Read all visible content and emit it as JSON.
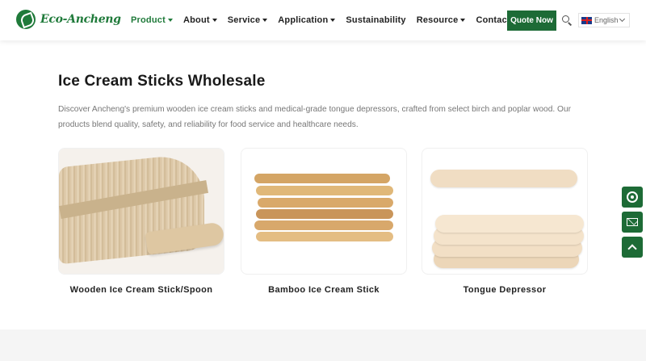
{
  "brand": {
    "name": "Eco-Ancheng",
    "accent": "#1d6b36"
  },
  "nav": {
    "items": [
      {
        "label": "Product",
        "dropdown": true,
        "active": true
      },
      {
        "label": "About",
        "dropdown": true,
        "active": false
      },
      {
        "label": "Service",
        "dropdown": true,
        "active": false
      },
      {
        "label": "Application",
        "dropdown": true,
        "active": false
      },
      {
        "label": "Sustainability",
        "dropdown": false,
        "active": false
      },
      {
        "label": "Resource",
        "dropdown": true,
        "active": false
      },
      {
        "label": "Contact",
        "dropdown": false,
        "active": false
      }
    ],
    "quote_label": "Quote Now",
    "language": "English"
  },
  "main": {
    "title": "Ice Cream Sticks Wholesale",
    "description": "Discover Ancheng's premium wooden ice cream sticks and medical-grade tongue depressors, crafted from select birch and poplar wood. Our products blend quality, safety, and reliability for food service and healthcare needs."
  },
  "products": [
    {
      "name": "Wooden Ice Cream Stick/Spoon"
    },
    {
      "name": "Bamboo Ice Cream Stick"
    },
    {
      "name": "Tongue Depressor"
    }
  ],
  "float_icons": [
    "whatsapp-icon",
    "mail-icon",
    "arrow-up-icon"
  ]
}
